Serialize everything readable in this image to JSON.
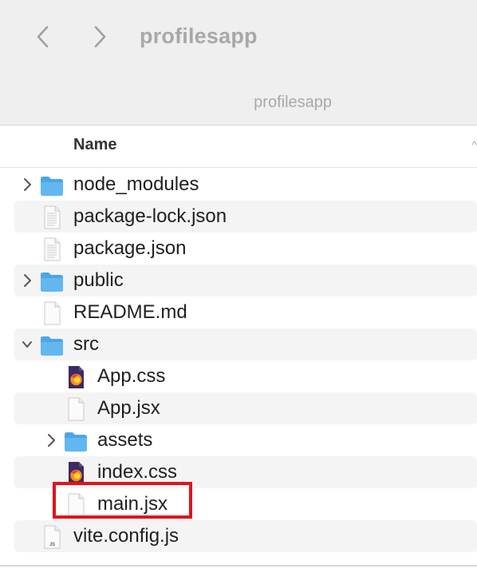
{
  "window": {
    "title": "profilesapp",
    "path_title": "profilesapp",
    "back_icon": "chevron-left-icon",
    "forward_icon": "chevron-right-icon"
  },
  "columns": {
    "name_header": "Name",
    "sort_indicator": "^"
  },
  "files": [
    {
      "name": "node_modules",
      "kind": "folder",
      "depth": 0,
      "disclosure": "collapsed",
      "icon": "folder-icon"
    },
    {
      "name": "package-lock.json",
      "kind": "file",
      "depth": 0,
      "icon": "json-file-icon"
    },
    {
      "name": "package.json",
      "kind": "file",
      "depth": 0,
      "icon": "json-file-icon"
    },
    {
      "name": "public",
      "kind": "folder",
      "depth": 0,
      "disclosure": "collapsed",
      "icon": "folder-icon"
    },
    {
      "name": "README.md",
      "kind": "file",
      "depth": 0,
      "icon": "blank-file-icon"
    },
    {
      "name": "src",
      "kind": "folder",
      "depth": 0,
      "disclosure": "expanded",
      "icon": "folder-icon"
    },
    {
      "name": "App.css",
      "kind": "file",
      "depth": 1,
      "icon": "firefox-css-file-icon"
    },
    {
      "name": "App.jsx",
      "kind": "file",
      "depth": 1,
      "icon": "blank-file-icon"
    },
    {
      "name": "assets",
      "kind": "folder",
      "depth": 1,
      "disclosure": "collapsed",
      "icon": "folder-icon"
    },
    {
      "name": "index.css",
      "kind": "file",
      "depth": 1,
      "icon": "firefox-css-file-icon"
    },
    {
      "name": "main.jsx",
      "kind": "file",
      "depth": 1,
      "icon": "blank-file-icon",
      "highlighted": true
    },
    {
      "name": "vite.config.js",
      "kind": "file",
      "depth": 0,
      "icon": "js-file-icon"
    }
  ],
  "colors": {
    "folder": "#5ab0ea",
    "highlight": "#e0141b",
    "alt_row": "#f4f4f4",
    "toolbar": "#efefef"
  }
}
